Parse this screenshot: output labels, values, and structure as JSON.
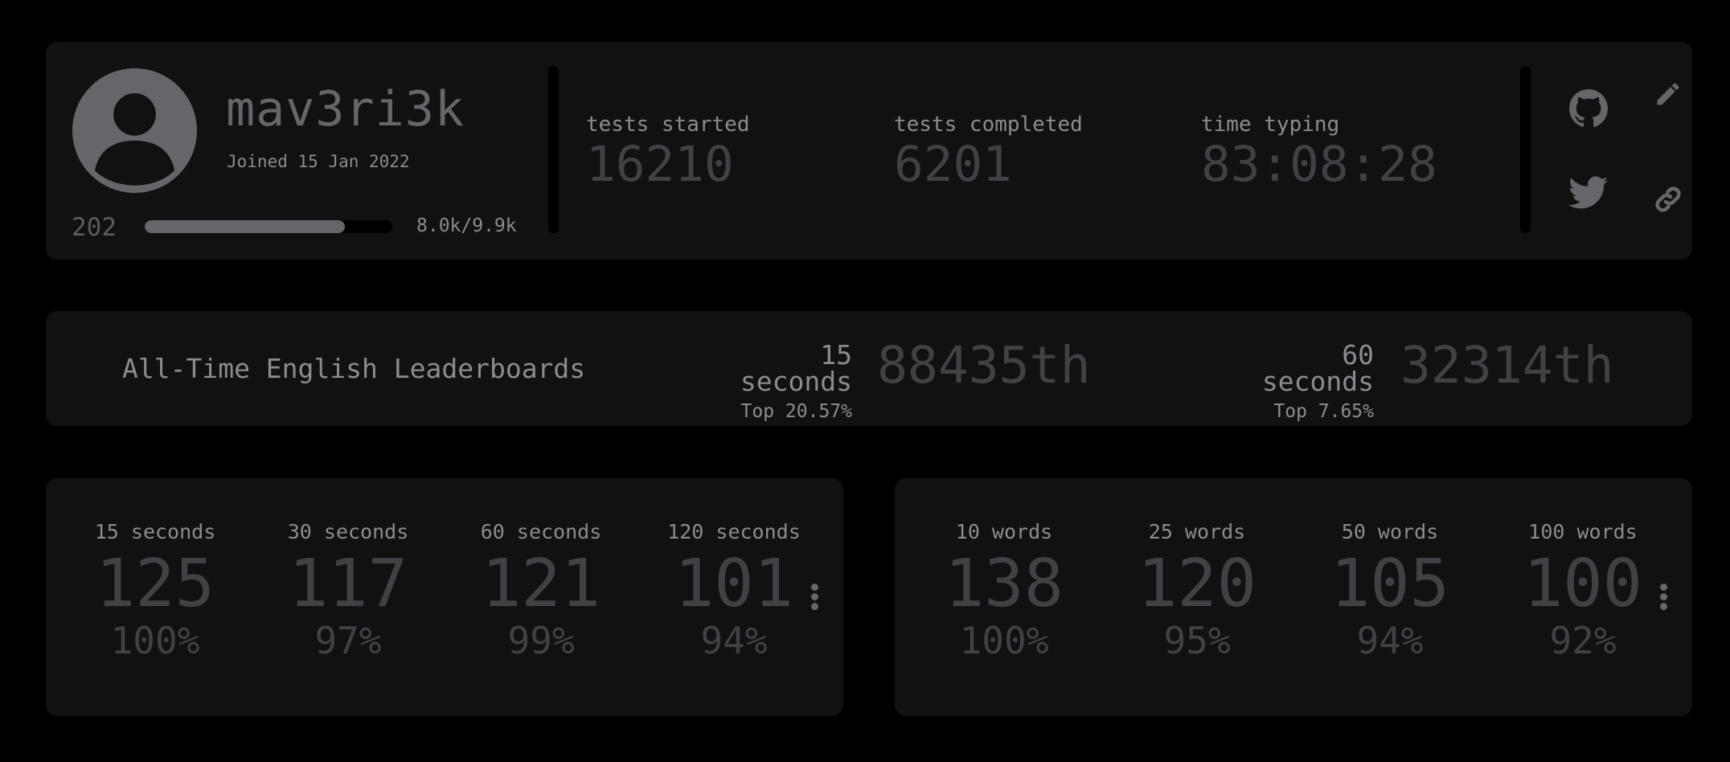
{
  "profile": {
    "username": "mav3ri3k",
    "joined": "Joined 15 Jan 2022",
    "level": "202",
    "xp_text": "8.0k/9.9k",
    "xp_progress": 0.81,
    "stats": [
      {
        "label": "tests started",
        "value": "16210"
      },
      {
        "label": "tests completed",
        "value": "6201"
      },
      {
        "label": "time typing",
        "value": "83:08:28"
      }
    ],
    "icons": {
      "github": "github-icon",
      "twitter": "twitter-icon",
      "edit": "pencil-icon",
      "link": "link-icon"
    }
  },
  "leaderboard": {
    "title": "All-Time English Leaderboards",
    "entries": [
      {
        "mode": "15 seconds",
        "top": "Top 20.57%",
        "rank": "88435th"
      },
      {
        "mode": "60 seconds",
        "top": "Top 7.65%",
        "rank": "32314th"
      }
    ]
  },
  "pb_time": [
    {
      "label": "15 seconds",
      "wpm": "125",
      "acc": "100%"
    },
    {
      "label": "30 seconds",
      "wpm": "117",
      "acc": "97%"
    },
    {
      "label": "60 seconds",
      "wpm": "121",
      "acc": "99%"
    },
    {
      "label": "120 seconds",
      "wpm": "101",
      "acc": "94%"
    }
  ],
  "pb_words": [
    {
      "label": "10 words",
      "wpm": "138",
      "acc": "100%"
    },
    {
      "label": "25 words",
      "wpm": "120",
      "acc": "95%"
    },
    {
      "label": "50 words",
      "wpm": "105",
      "acc": "94%"
    },
    {
      "label": "100 words",
      "wpm": "100",
      "acc": "92%"
    }
  ],
  "colors": {
    "background": "#000000",
    "panel": "#111111",
    "sub": "#646669",
    "text_dim": "#3f4145"
  }
}
